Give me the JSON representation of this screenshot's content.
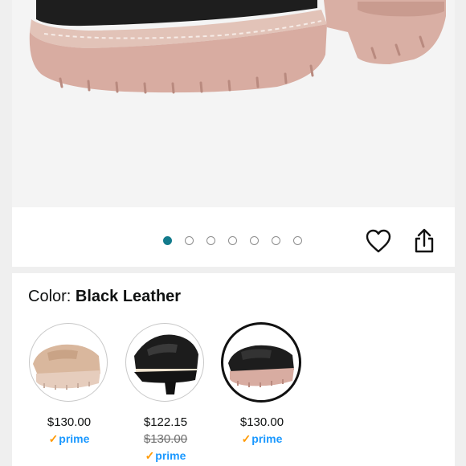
{
  "gallery": {
    "image_count": 7,
    "active_index": 0,
    "accent_color": "#137b8c",
    "image_alt": "Black leather lug-sole loafer, close-up of front"
  },
  "actions": {
    "wishlist_icon": "heart-icon",
    "share_icon": "share-icon"
  },
  "color_selector": {
    "label": "Color: ",
    "value": "Black Leather",
    "options": [
      {
        "name": "Tan",
        "price": "$130.00",
        "list_price": "",
        "prime": "prime"
      },
      {
        "name": "Black Leather Cream Sole",
        "price": "$122.15",
        "list_price": "$130.00",
        "prime": "prime"
      },
      {
        "name": "Black Leather",
        "price": "$130.00",
        "list_price": "",
        "prime": "prime"
      }
    ]
  },
  "colors": {
    "prime_blue": "#1a98ff",
    "prime_check": "#ff9900",
    "sole_pink": "#dcb2a7"
  }
}
